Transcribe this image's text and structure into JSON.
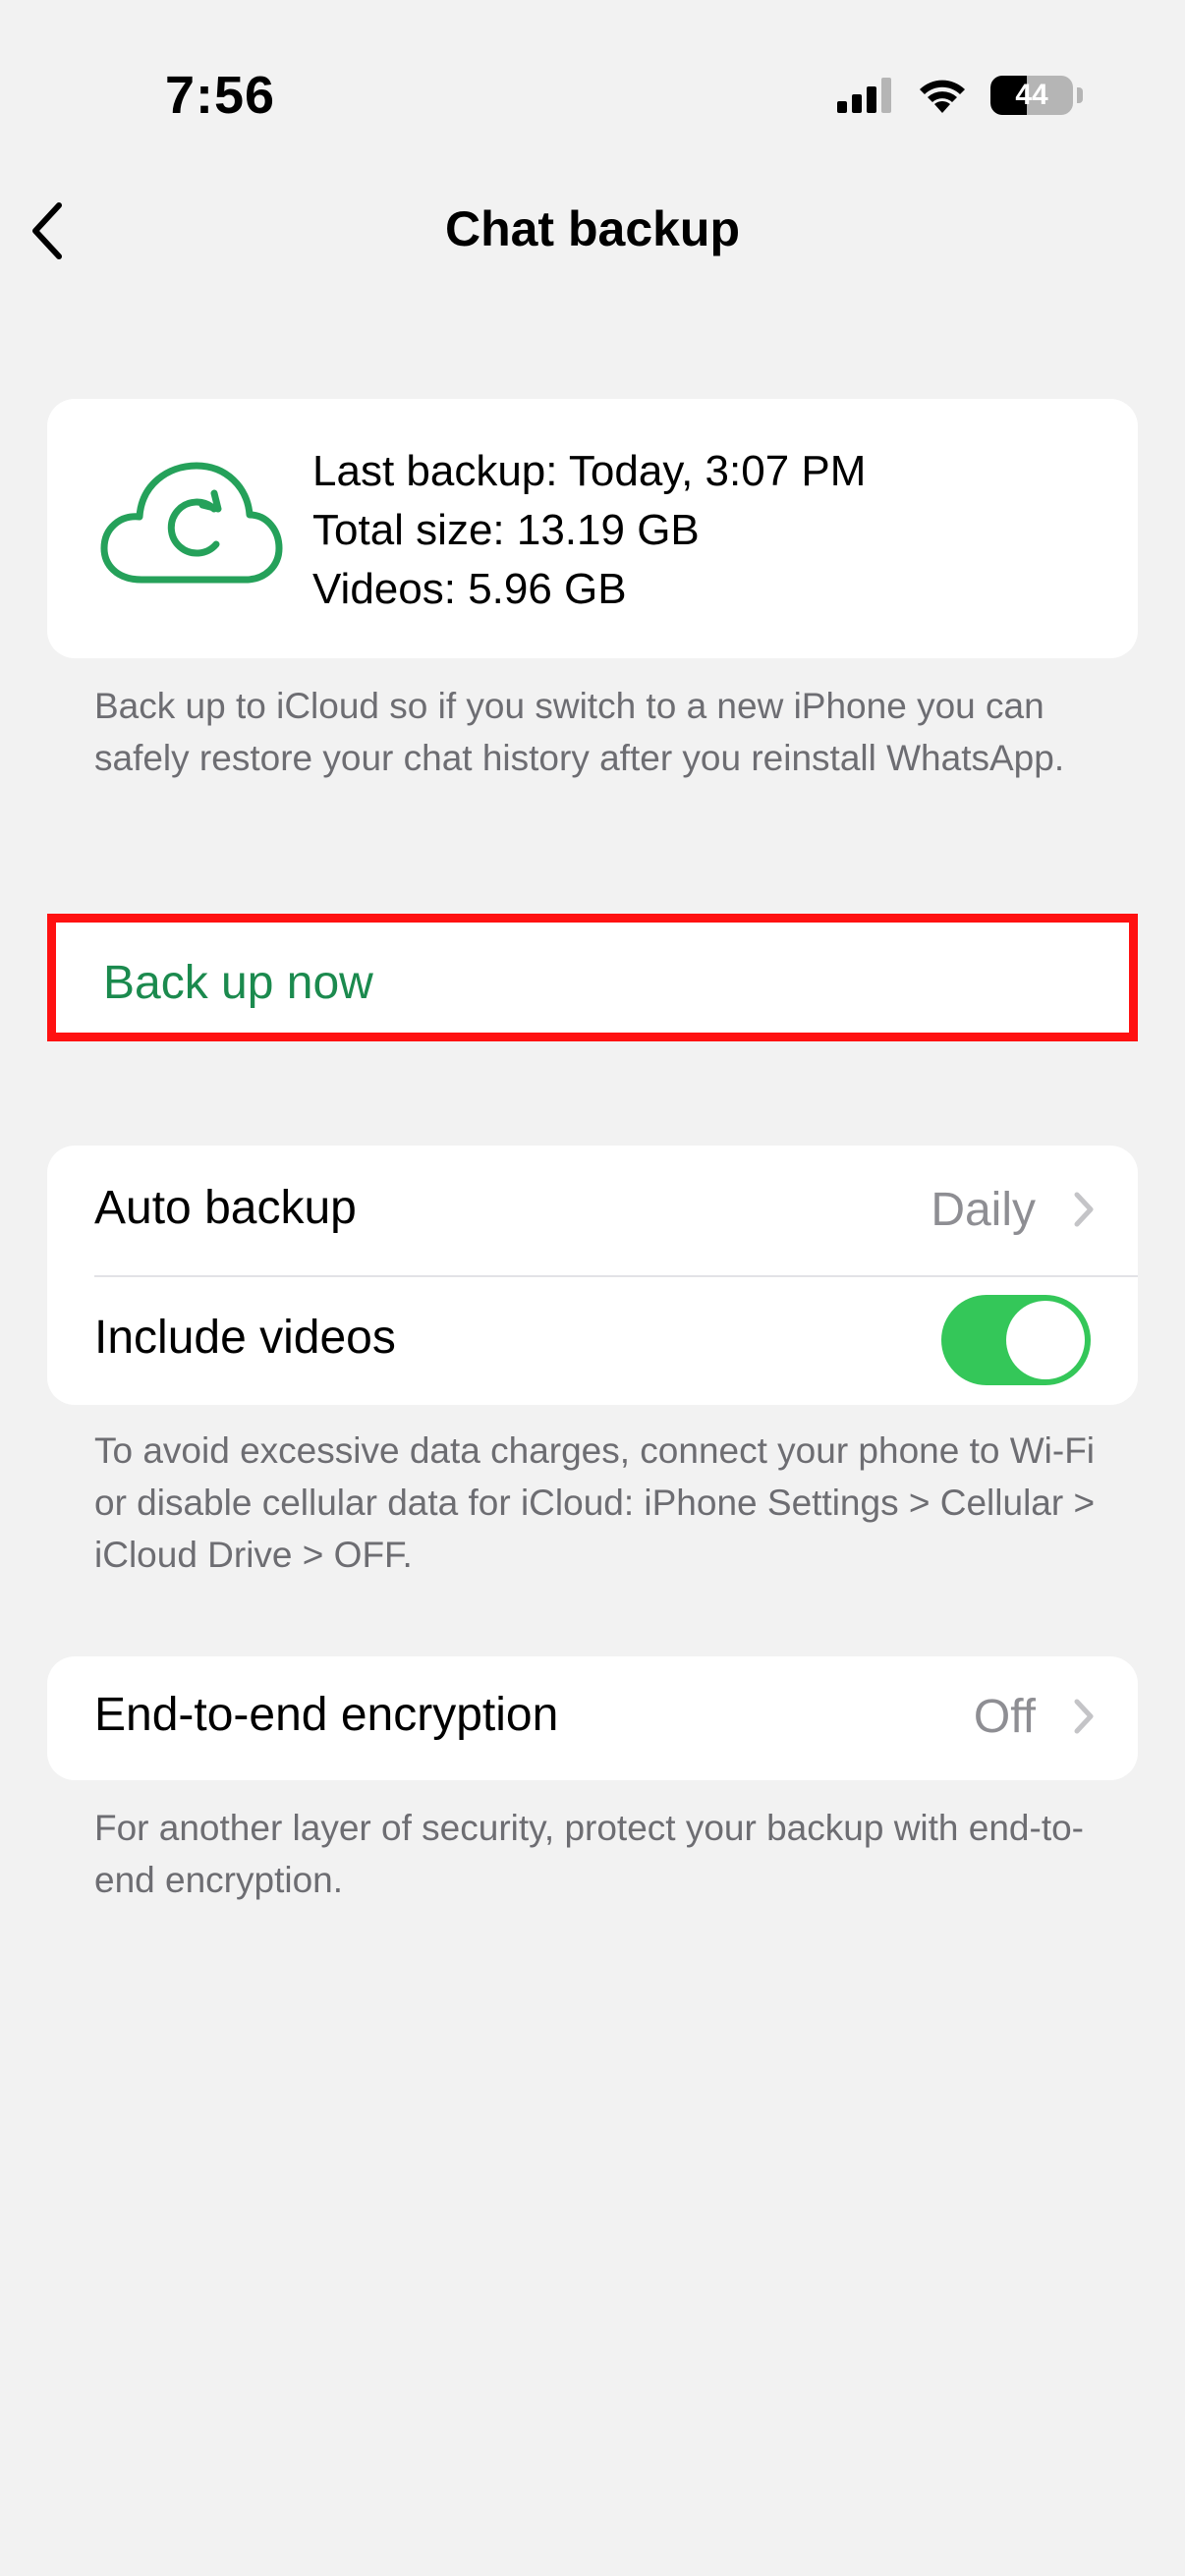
{
  "status_bar": {
    "time": "7:56",
    "battery": "44",
    "battery_level": 0.44
  },
  "nav": {
    "title": "Chat backup"
  },
  "backup_info": {
    "last_backup": "Last backup: Today, 3:07 PM",
    "total_size": "Total size: 13.19 GB",
    "videos_size": "Videos: 5.96 GB",
    "icon": "cloud-sync-icon",
    "icon_color": "#25a15a"
  },
  "icloud_description": "Back up to iCloud so if you switch to a new iPhone you can safely restore your chat history after you reinstall WhatsApp.",
  "back_up_now": {
    "label": "Back up now",
    "color": "#1b8a4e",
    "highlight_color": "#ff1111"
  },
  "settings": {
    "auto_backup": {
      "label": "Auto backup",
      "value": "Daily"
    },
    "include_videos": {
      "label": "Include videos",
      "enabled": true,
      "toggle_color": "#34c759"
    }
  },
  "data_charges_note": "To avoid excessive data charges, connect your phone to Wi-Fi or disable cellular data for iCloud: iPhone Settings > Cellular > iCloud Drive > OFF.",
  "encryption": {
    "label": "End-to-end encryption",
    "value": "Off",
    "description": "For another layer of security, protect your backup with end-to-end encryption."
  }
}
